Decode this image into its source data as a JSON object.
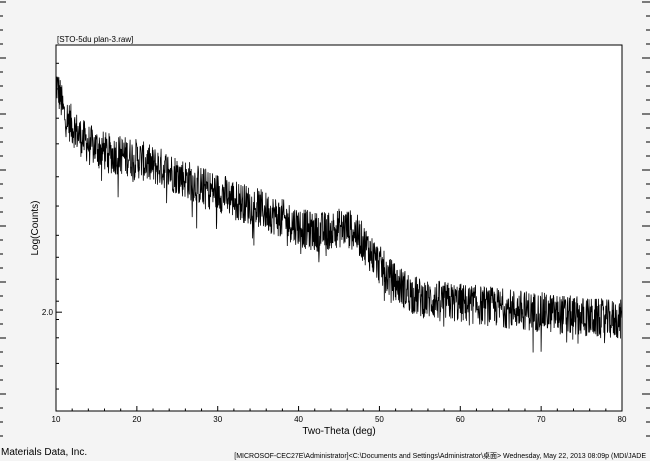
{
  "chart_data": {
    "type": "line",
    "title": "[STO-5du plan-3.raw]",
    "xlabel": "Two-Theta (deg)",
    "ylabel": "Log(Counts)",
    "xlim": [
      10,
      80
    ],
    "x_ticks": [
      10,
      20,
      30,
      40,
      50,
      60,
      70,
      80
    ],
    "y_scale": "log",
    "y_tick_labels": [
      "2.0"
    ],
    "grid": false,
    "series": [
      {
        "profile": [
          [
            10.0,
            0.9
          ],
          [
            10.5,
            0.86
          ],
          [
            11.0,
            0.81
          ],
          [
            12.0,
            0.78
          ],
          [
            13.0,
            0.75
          ],
          [
            14.0,
            0.73
          ],
          [
            15.0,
            0.72
          ],
          [
            16.0,
            0.71
          ],
          [
            17.0,
            0.7
          ],
          [
            18.0,
            0.7
          ],
          [
            19.0,
            0.695
          ],
          [
            20.0,
            0.69
          ],
          [
            21.0,
            0.68
          ],
          [
            22.0,
            0.67
          ],
          [
            23.0,
            0.665
          ],
          [
            24.0,
            0.655
          ],
          [
            25.0,
            0.645
          ],
          [
            26.0,
            0.635
          ],
          [
            27.0,
            0.625
          ],
          [
            28.0,
            0.615
          ],
          [
            29.0,
            0.605
          ],
          [
            30.0,
            0.598
          ],
          [
            31.0,
            0.59
          ],
          [
            32.0,
            0.58
          ],
          [
            33.0,
            0.57
          ],
          [
            34.0,
            0.562
          ],
          [
            35.0,
            0.555
          ],
          [
            36.0,
            0.545
          ],
          [
            37.0,
            0.535
          ],
          [
            38.0,
            0.525
          ],
          [
            39.0,
            0.515
          ],
          [
            40.0,
            0.505
          ],
          [
            41.0,
            0.495
          ],
          [
            42.0,
            0.49
          ],
          [
            43.0,
            0.49
          ],
          [
            44.0,
            0.495
          ],
          [
            45.0,
            0.5
          ],
          [
            46.0,
            0.5
          ],
          [
            47.0,
            0.49
          ],
          [
            48.0,
            0.46
          ],
          [
            49.0,
            0.43
          ],
          [
            50.0,
            0.4
          ],
          [
            51.0,
            0.37
          ],
          [
            52.0,
            0.35
          ],
          [
            53.0,
            0.335
          ],
          [
            54.0,
            0.32
          ],
          [
            55.0,
            0.31
          ],
          [
            56.0,
            0.305
          ],
          [
            58.0,
            0.3
          ],
          [
            60.0,
            0.295
          ],
          [
            62.0,
            0.29
          ],
          [
            64.0,
            0.285
          ],
          [
            66.0,
            0.28
          ],
          [
            68.0,
            0.275
          ],
          [
            70.0,
            0.27
          ],
          [
            72.0,
            0.265
          ],
          [
            74.0,
            0.26
          ],
          [
            76.0,
            0.255
          ],
          [
            78.0,
            0.25
          ],
          [
            80.0,
            0.25
          ]
        ],
        "noise_amplitude": 0.055
      }
    ]
  },
  "footer": {
    "left": "Materials Data, Inc.",
    "right": "[MICROSOF-CEC27E\\Administrator]<C:\\Documents and Settings\\Administrator\\桌面> Wednesday, May 22, 2013 08:09p (MDI/JADE"
  }
}
